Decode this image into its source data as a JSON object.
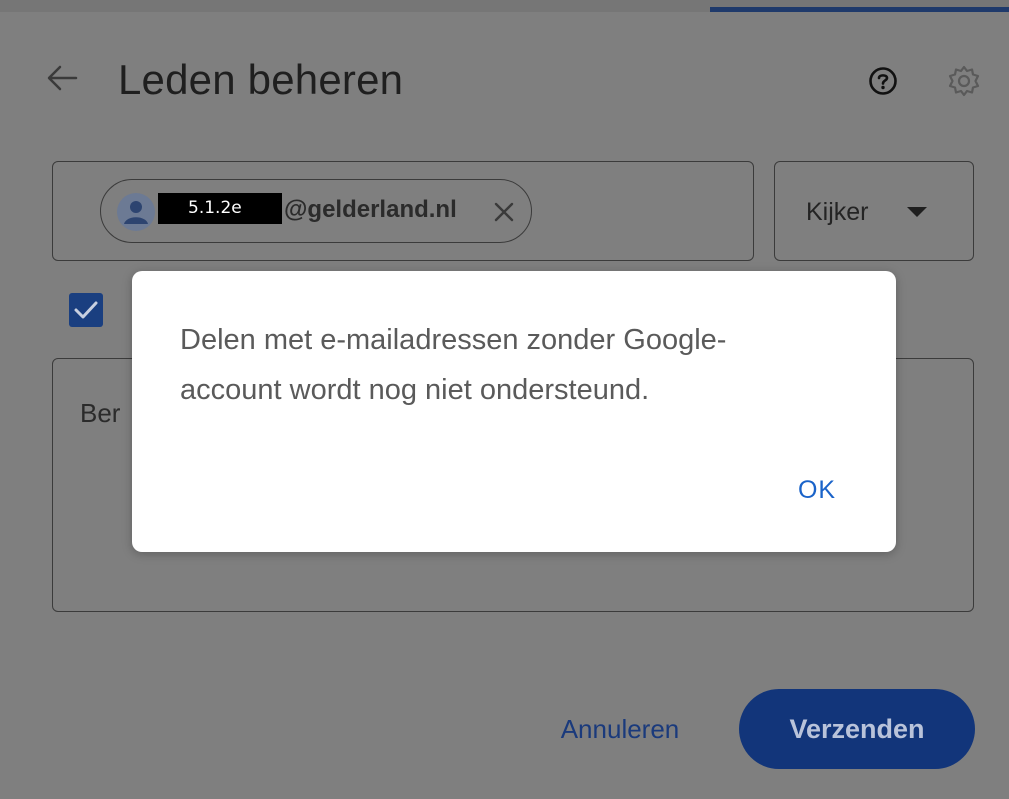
{
  "header": {
    "title": "Leden beheren",
    "back_icon": "arrow-left-icon",
    "help_icon": "help-circle-icon",
    "settings_icon": "gear-icon"
  },
  "recipients": {
    "chip": {
      "redaction_label": "5.1.2e",
      "domain": "@gelderland.nl",
      "avatar_icon": "person-avatar-icon",
      "remove_icon": "close-icon"
    }
  },
  "role": {
    "selected": "Kijker",
    "caret_icon": "caret-down-icon"
  },
  "notify": {
    "checked": true
  },
  "message": {
    "placeholder_visible": "Ber"
  },
  "actions": {
    "cancel_label": "Annuleren",
    "send_label": "Verzenden"
  },
  "alert": {
    "line1": "Delen met e-mailadressen zonder Google-",
    "line2": "account wordt nog niet ondersteund.",
    "ok_label": "OK"
  },
  "colors": {
    "page_dim": "#7f7f7f",
    "send_button": "#12357a",
    "ok_text": "#1a63c9",
    "checkbox": "#1a3f80"
  }
}
